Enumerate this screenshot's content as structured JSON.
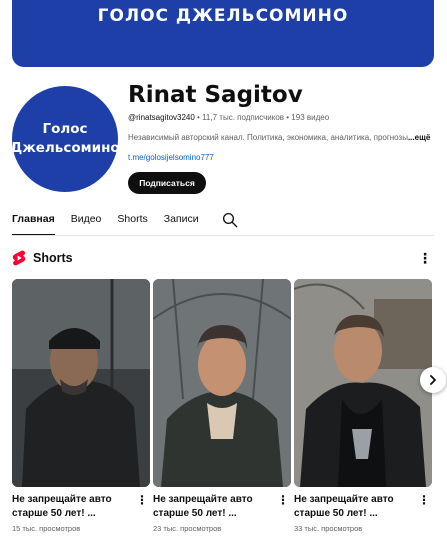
{
  "banner": {
    "text": "ГОЛОС ДЖЕЛЬСОМИНО"
  },
  "avatar": {
    "line1": "Голос",
    "line2": "Джельсомино"
  },
  "channel": {
    "name": "Rinat Sagitov",
    "handle": "@rinatsagitov3240",
    "stats": " • 11,7 тыс. подписчиков • 193 видео",
    "description": "Независимый авторский канал. Политика, экономика, аналитика, прогнозы",
    "more": "...ещё",
    "link": "t.me/golosijelsomino777",
    "subscribe_label": "Подписаться"
  },
  "tabs": [
    {
      "label": "Главная"
    },
    {
      "label": "Видео"
    },
    {
      "label": "Shorts"
    },
    {
      "label": "Записи"
    }
  ],
  "shorts_section": {
    "title": "Shorts",
    "more_icon": "kebab-icon"
  },
  "cards": [
    {
      "title": "Не запрещайте авто старше 50 лет! ...",
      "views": "15 тыс. просмотров"
    },
    {
      "title": "Не запрещайте авто старше 50 лет! ...",
      "views": "23 тыс. просмотров"
    },
    {
      "title": "Не запрещайте авто старше 50 лет! ...",
      "views": "33 тыс. просмотров"
    }
  ],
  "colors": {
    "brand_blue": "#1e3fa8",
    "shorts_red": "#ff0033",
    "link": "#065fd4"
  }
}
